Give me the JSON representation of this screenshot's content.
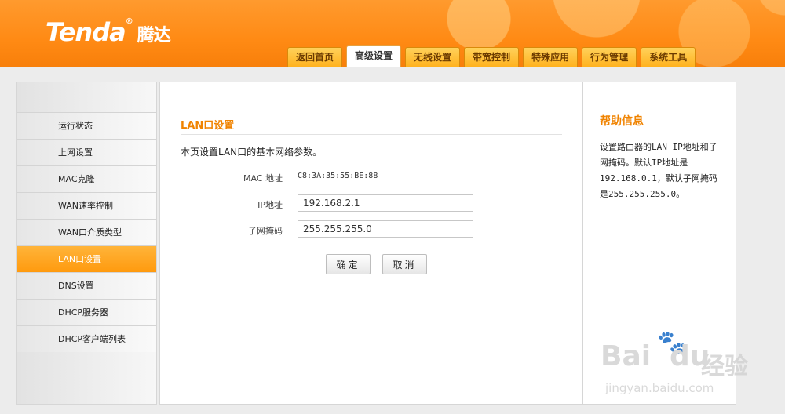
{
  "header": {
    "logo_text": "Tenda",
    "logo_reg": "®",
    "logo_cn": "腾达",
    "tabs": [
      "返回首页",
      "高级设置",
      "无线设置",
      "带宽控制",
      "特殊应用",
      "行为管理",
      "系统工具"
    ],
    "active_tab": "高级设置",
    "accent_color": "#ff8a14"
  },
  "sidebar": {
    "items": [
      "运行状态",
      "上网设置",
      "MAC克隆",
      "WAN速率控制",
      "WAN口介质类型",
      "LAN口设置",
      "DNS设置",
      "DHCP服务器",
      "DHCP客户端列表"
    ],
    "active_item": "LAN口设置"
  },
  "main": {
    "title": "LAN口设置",
    "description": "本页设置LAN口的基本网络参数。",
    "mac_label": "MAC 地址",
    "mac_value": "C8:3A:35:55:BE:88",
    "ip_label": "IP地址",
    "ip_value": "192.168.2.1",
    "mask_label": "子网掩码",
    "mask_value": "255.255.255.0",
    "ok_button": "确定",
    "cancel_button": "取消"
  },
  "help": {
    "title": "帮助信息",
    "text": "设置路由器的LAN IP地址和子网掩码。默认IP地址是192.168.0.1，默认子网掩码是255.255.255.0。"
  },
  "watermark": {
    "main": "Bai",
    "paw": "🐾",
    "du": "du",
    "cn": "经验",
    "sub": "jingyan.baidu.com"
  }
}
